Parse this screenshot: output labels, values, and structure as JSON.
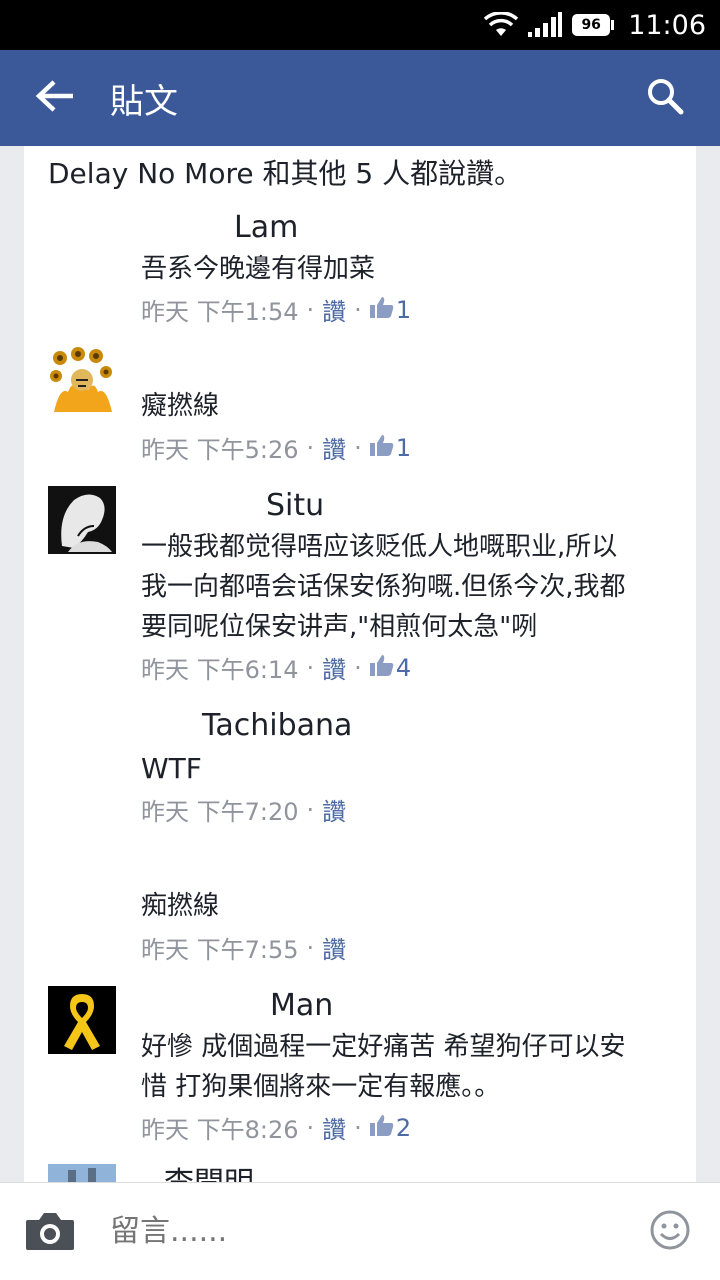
{
  "status_bar": {
    "battery": "96",
    "time": "11:06"
  },
  "header": {
    "title": "貼文"
  },
  "likes_summary": "Delay No More 和其他 5 人都說讚。",
  "comments": [
    {
      "name": "Lam",
      "body": "吾系今晚邊有得加菜",
      "time": "昨天 下午1:54",
      "like_label": "讚",
      "likes": "1"
    },
    {
      "name": "",
      "body": "癡撚線",
      "time": "昨天 下午5:26",
      "like_label": "讚",
      "likes": "1"
    },
    {
      "name": "Situ",
      "body": "一般我都觉得唔应该贬低人地嘅职业,所以我一向都唔会话保安係狗嘅.但係今次,我都要同呢位保安讲声,\"相煎何太急\"咧",
      "time": "昨天 下午6:14",
      "like_label": "讚",
      "likes": "4"
    },
    {
      "name": "Tachibana",
      "body": "WTF",
      "time": "昨天 下午7:20",
      "like_label": "讚"
    },
    {
      "name": "",
      "body": "痴撚線",
      "time": "昨天 下午7:55",
      "like_label": "讚"
    },
    {
      "name": "Man",
      "body": "好慘 成個過程一定好痛苦 希望狗仔可以安惜 打狗果個將來一定有報應。。",
      "time": "昨天 下午8:26",
      "like_label": "讚",
      "likes": "2"
    },
    {
      "name": "李開明"
    }
  ],
  "composer": {
    "placeholder": "留言......"
  }
}
